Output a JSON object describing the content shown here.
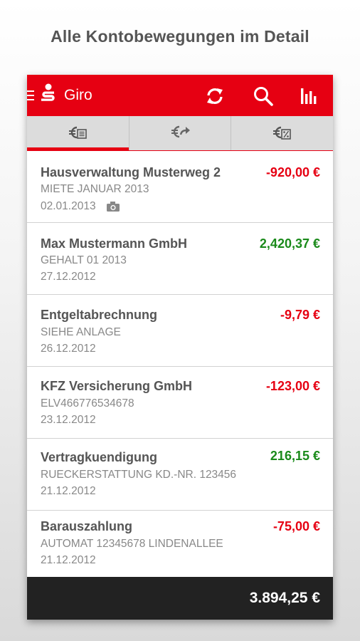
{
  "headline": "Alle Kontobewegungen im Detail",
  "appbar": {
    "title": "Giro",
    "icons": [
      "menu-icon",
      "sparkasse-logo",
      "refresh-icon",
      "search-icon",
      "bar-chart-icon"
    ],
    "background": "#e60012"
  },
  "tabs": [
    {
      "icon": "euro-statement-icon",
      "active": true
    },
    {
      "icon": "euro-transfer-icon",
      "active": false
    },
    {
      "icon": "euro-percent-icon",
      "active": false
    }
  ],
  "transactions": [
    {
      "name": "Hausverwaltung Musterweg 2",
      "purpose": "MIETE JANUAR 2013",
      "date": "02.01.2013",
      "amount": "-920,00 €",
      "direction": "debit",
      "attachment": "camera-icon"
    },
    {
      "name": "Max Mustermann GmbH",
      "purpose": "GEHALT 01 2013",
      "date": "27.12.2012",
      "amount": "2,420,37 €",
      "direction": "credit"
    },
    {
      "name": "Entgeltabrechnung",
      "purpose": "SIEHE ANLAGE",
      "date": "26.12.2012",
      "amount": "-9,79 €",
      "direction": "debit"
    },
    {
      "name": "KFZ Versicherung GmbH",
      "purpose": "ELV466776534678",
      "date": "23.12.2012",
      "amount": "-123,00 €",
      "direction": "debit"
    },
    {
      "name": "Vertragkuendigung",
      "purpose": "RUECKERSTATTUNG KD.-NR. 123456",
      "date": "21.12.2012",
      "amount": "216,15 €",
      "direction": "credit"
    },
    {
      "name": "Barauszahlung",
      "purpose": "AUTOMAT 12345678 LINDENALLEE",
      "date": "21.12.2012",
      "amount": "-75,00 €",
      "direction": "debit"
    }
  ],
  "footer": {
    "balance": "3.894,25 €"
  },
  "colors": {
    "debit": "#e60012",
    "credit": "#1a8a1a"
  }
}
